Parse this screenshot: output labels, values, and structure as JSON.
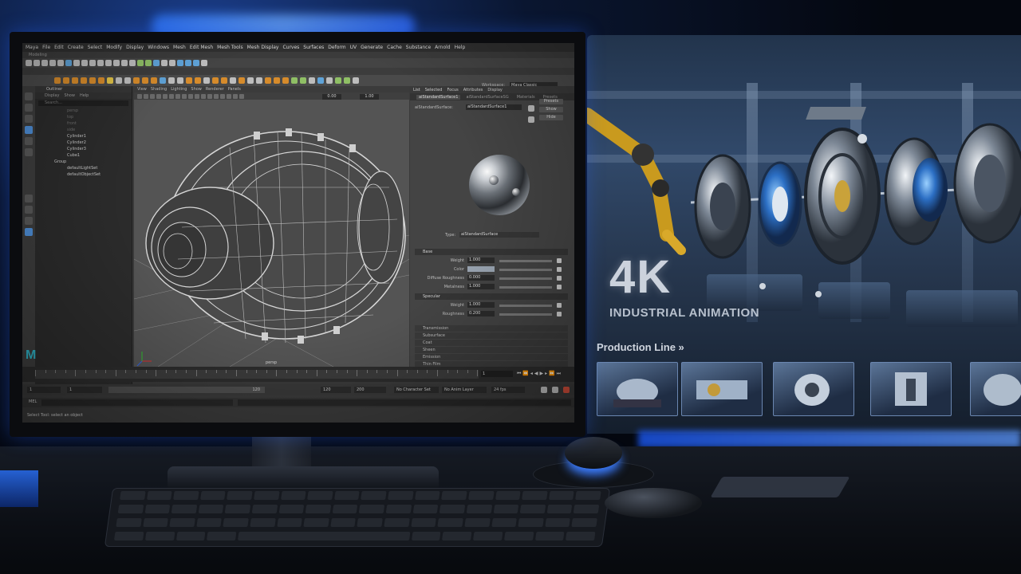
{
  "maya": {
    "menubar": [
      "Maya",
      "File",
      "Edit",
      "Create",
      "Select",
      "Modify",
      "Display",
      "Windows",
      "Mesh",
      "Edit Mesh",
      "Mesh Tools",
      "Mesh Display",
      "Curves",
      "Surfaces",
      "Deform",
      "UV",
      "Generate",
      "Cache",
      "Substance",
      "Arnold",
      "Help"
    ],
    "mode_dropdown": "Modeling",
    "workspace_label": "Workspace:",
    "workspace_value": "Maya Classic",
    "outliner": {
      "title": "Outliner",
      "menu": [
        "Display",
        "Show",
        "Help"
      ],
      "search": "Search...",
      "items": [
        {
          "label": "persp",
          "dim": true
        },
        {
          "label": "top",
          "dim": true
        },
        {
          "label": "front",
          "dim": true
        },
        {
          "label": "side",
          "dim": true
        },
        {
          "label": "Cylinder1",
          "dim": false
        },
        {
          "label": "Cylinder2",
          "dim": false
        },
        {
          "label": "Cylinder3",
          "dim": false
        },
        {
          "label": "Cube1",
          "dim": false
        },
        {
          "label": "Group",
          "dim": false
        },
        {
          "label": "defaultLightSet",
          "dim": false
        },
        {
          "label": "defaultObjectSet",
          "dim": false
        }
      ]
    },
    "viewport": {
      "menu": [
        "View",
        "Shading",
        "Lighting",
        "Show",
        "Renderer",
        "Panels"
      ],
      "field1": "0.00",
      "field2": "1.00",
      "camera": "persp"
    },
    "attribute_editor": {
      "tabs": [
        "List",
        "Selected",
        "Focus",
        "Attributes",
        "Display"
      ],
      "subtabs": [
        "aiStandardSurface1",
        "aiStandardSurfaceSG",
        "Materials",
        "Presets"
      ],
      "node_label": "aiStandardSurface:",
      "node_value": "aiStandardSurface1",
      "buttons": [
        "Presets",
        "Show",
        "Hide"
      ],
      "type_label": "Type:",
      "type_value": "aiStandardSurface",
      "sections": {
        "base": "Base",
        "specular": "Specular",
        "closed": [
          "Transmission",
          "Subsurface",
          "Coat",
          "Sheen",
          "Emission",
          "Thin Film"
        ]
      },
      "base_attrs": [
        {
          "label": "Weight",
          "value": "1.000"
        },
        {
          "label": "Color",
          "value": ""
        },
        {
          "label": "Diffuse Roughness",
          "value": "0.000"
        },
        {
          "label": "Metalness",
          "value": "1.000"
        }
      ],
      "specular_attrs": [
        {
          "label": "Weight",
          "value": "1.000"
        },
        {
          "label": "Roughness",
          "value": "0.200"
        }
      ]
    },
    "timeline": {
      "current": "1",
      "range": {
        "start": "1",
        "play_start": "1",
        "play_end": "120",
        "end": "120",
        "end2": "200"
      },
      "character_set": "No Character Set",
      "anim_layer": "No Anim Layer",
      "fps": "24 fps"
    },
    "cmd_label": "MEL",
    "help_text": "Select Tool: select an object"
  },
  "showcase": {
    "headline": "4K",
    "subtitle": "INDUSTRIAL ANIMATION",
    "section": "Production Line »"
  }
}
